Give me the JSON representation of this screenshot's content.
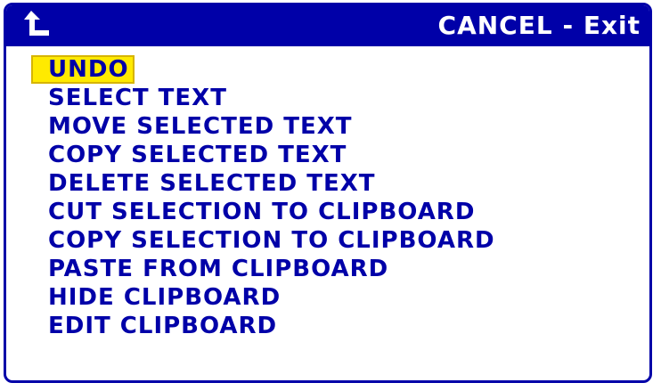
{
  "window": {
    "title": "CANCEL - Exit",
    "back_icon": "back-arrow-icon",
    "accent_color": "#0000a8",
    "highlight_color": "#ffea00"
  },
  "menu": {
    "items": [
      {
        "label": "UNDO",
        "selected": true
      },
      {
        "label": "SELECT TEXT",
        "selected": false
      },
      {
        "label": "MOVE SELECTED TEXT",
        "selected": false
      },
      {
        "label": "COPY SELECTED TEXT",
        "selected": false
      },
      {
        "label": "DELETE SELECTED TEXT",
        "selected": false
      },
      {
        "label": "CUT SELECTION TO CLIPBOARD",
        "selected": false
      },
      {
        "label": "COPY SELECTION TO CLIPBOARD",
        "selected": false
      },
      {
        "label": "PASTE FROM CLIPBOARD",
        "selected": false
      },
      {
        "label": "HIDE CLIPBOARD",
        "selected": false
      },
      {
        "label": "EDIT CLIPBOARD",
        "selected": false
      }
    ]
  }
}
